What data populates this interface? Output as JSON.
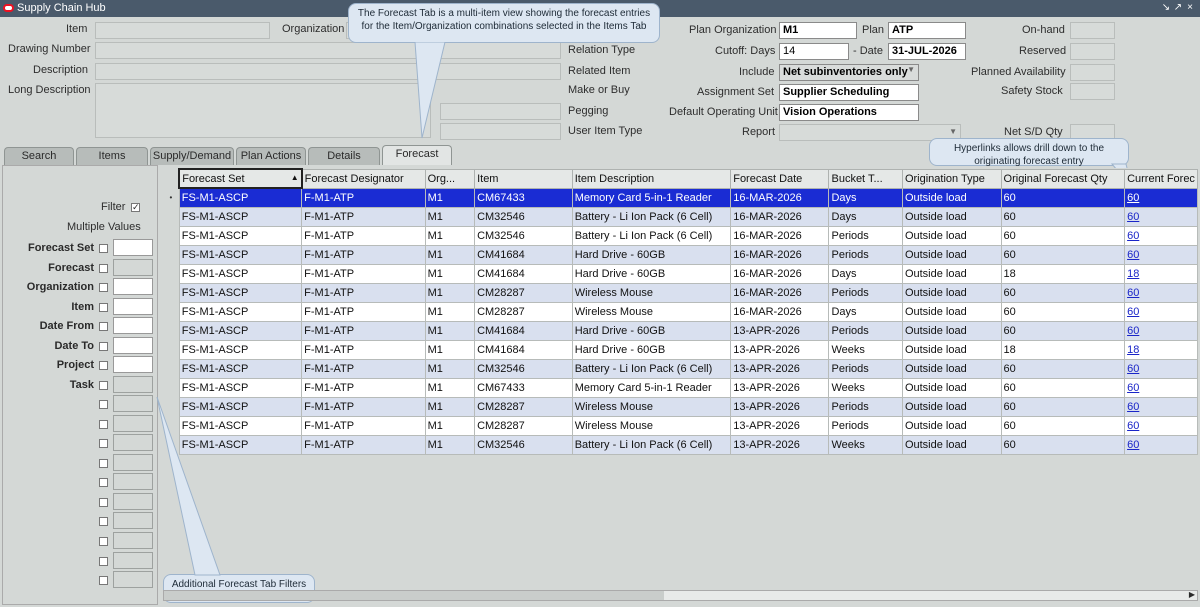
{
  "window": {
    "title": "Supply Chain Hub",
    "controls": [
      "↘",
      "↗",
      "×"
    ]
  },
  "header": {
    "item_label": "Item",
    "organization_label": "Organization",
    "drawing_number_label": "Drawing Number",
    "description_label": "Description",
    "long_description_label": "Long Description",
    "relation_type_label": "Relation Type",
    "related_item_label": "Related Item",
    "make_or_buy_label": "Make or Buy",
    "pegging_label": "Pegging",
    "user_item_type_label": "User Item Type",
    "plan_org_label": "Plan Organization",
    "plan_org_value": "M1",
    "plan_label": "Plan",
    "plan_value": "ATP",
    "cutoff_label": "Cutoff: Days",
    "cutoff_days_value": "14",
    "date_label": "- Date",
    "date_value": "31-JUL-2026",
    "include_label": "Include",
    "include_value": "Net subinventories only",
    "assignment_set_label": "Assignment Set",
    "assignment_set_value": "Supplier Scheduling",
    "default_ou_label": "Default Operating Unit",
    "default_ou_value": "Vision Operations",
    "report_label": "Report",
    "on_hand_label": "On-hand",
    "reserved_label": "Reserved",
    "planned_availability_label": "Planned Availability",
    "safety_stock_label": "Safety Stock",
    "net_sd_qty_label": "Net S/D Qty"
  },
  "callouts": {
    "forecast_tab": "The Forecast Tab is a multi-item view showing the forecast entries for the Item/Organization combinations selected in the Items Tab",
    "hyperlinks": "Hyperlinks allows drill down to the originating forecast entry",
    "filters": "Additional Forecast Tab Filters"
  },
  "tabs": [
    {
      "label": "Search",
      "active": false
    },
    {
      "label": "Items",
      "active": false
    },
    {
      "label": "Supply/Demand",
      "active": false
    },
    {
      "label": "Plan Actions",
      "active": false
    },
    {
      "label": "Details",
      "active": false
    },
    {
      "label": "Forecast",
      "active": true
    }
  ],
  "filters": {
    "filter_label": "Filter",
    "filter_checked": true,
    "multiple_values_label": "Multiple Values",
    "fields": [
      "Forecast Set",
      "Forecast",
      "Organization",
      "Item",
      "Date From",
      "Date To",
      "Project",
      "Task"
    ]
  },
  "grid": {
    "columns": [
      "Forecast Set",
      "Forecast Designator",
      "Org...",
      "Item",
      "Item Description",
      "Forecast Date",
      "Bucket T...",
      "Origination Type",
      "Original Forecast Qty",
      "Current Forec"
    ],
    "rows": [
      [
        "FS-M1-ASCP",
        "F-M1-ATP",
        "M1",
        "CM67433",
        "Memory Card 5-in-1 Reader",
        "16-MAR-2026",
        "Days",
        "Outside load",
        "60",
        "60"
      ],
      [
        "FS-M1-ASCP",
        "F-M1-ATP",
        "M1",
        "CM32546",
        "Battery -  Li Ion Pack (6 Cell)",
        "16-MAR-2026",
        "Days",
        "Outside load",
        "60",
        "60"
      ],
      [
        "FS-M1-ASCP",
        "F-M1-ATP",
        "M1",
        "CM32546",
        "Battery -  Li Ion Pack (6 Cell)",
        "16-MAR-2026",
        "Periods",
        "Outside load",
        "60",
        "60"
      ],
      [
        "FS-M1-ASCP",
        "F-M1-ATP",
        "M1",
        "CM41684",
        "Hard Drive - 60GB",
        "16-MAR-2026",
        "Periods",
        "Outside load",
        "60",
        "60"
      ],
      [
        "FS-M1-ASCP",
        "F-M1-ATP",
        "M1",
        "CM41684",
        "Hard Drive - 60GB",
        "16-MAR-2026",
        "Days",
        "Outside load",
        "18",
        "18"
      ],
      [
        "FS-M1-ASCP",
        "F-M1-ATP",
        "M1",
        "CM28287",
        "Wireless Mouse",
        "16-MAR-2026",
        "Periods",
        "Outside load",
        "60",
        "60"
      ],
      [
        "FS-M1-ASCP",
        "F-M1-ATP",
        "M1",
        "CM28287",
        "Wireless Mouse",
        "16-MAR-2026",
        "Days",
        "Outside load",
        "60",
        "60"
      ],
      [
        "FS-M1-ASCP",
        "F-M1-ATP",
        "M1",
        "CM41684",
        "Hard Drive - 60GB",
        "13-APR-2026",
        "Periods",
        "Outside load",
        "60",
        "60"
      ],
      [
        "FS-M1-ASCP",
        "F-M1-ATP",
        "M1",
        "CM41684",
        "Hard Drive - 60GB",
        "13-APR-2026",
        "Weeks",
        "Outside load",
        "18",
        "18"
      ],
      [
        "FS-M1-ASCP",
        "F-M1-ATP",
        "M1",
        "CM32546",
        "Battery -  Li Ion Pack (6 Cell)",
        "13-APR-2026",
        "Periods",
        "Outside load",
        "60",
        "60"
      ],
      [
        "FS-M1-ASCP",
        "F-M1-ATP",
        "M1",
        "CM67433",
        "Memory Card 5-in-1 Reader",
        "13-APR-2026",
        "Weeks",
        "Outside load",
        "60",
        "60"
      ],
      [
        "FS-M1-ASCP",
        "F-M1-ATP",
        "M1",
        "CM28287",
        "Wireless Mouse",
        "13-APR-2026",
        "Periods",
        "Outside load",
        "60",
        "60"
      ],
      [
        "FS-M1-ASCP",
        "F-M1-ATP",
        "M1",
        "CM28287",
        "Wireless Mouse",
        "13-APR-2026",
        "Periods",
        "Outside load",
        "60",
        "60"
      ],
      [
        "FS-M1-ASCP",
        "F-M1-ATP",
        "M1",
        "CM32546",
        "Battery -  Li Ion Pack (6 Cell)",
        "13-APR-2026",
        "Weeks",
        "Outside load",
        "60",
        "60"
      ]
    ],
    "selected_row": 0
  }
}
